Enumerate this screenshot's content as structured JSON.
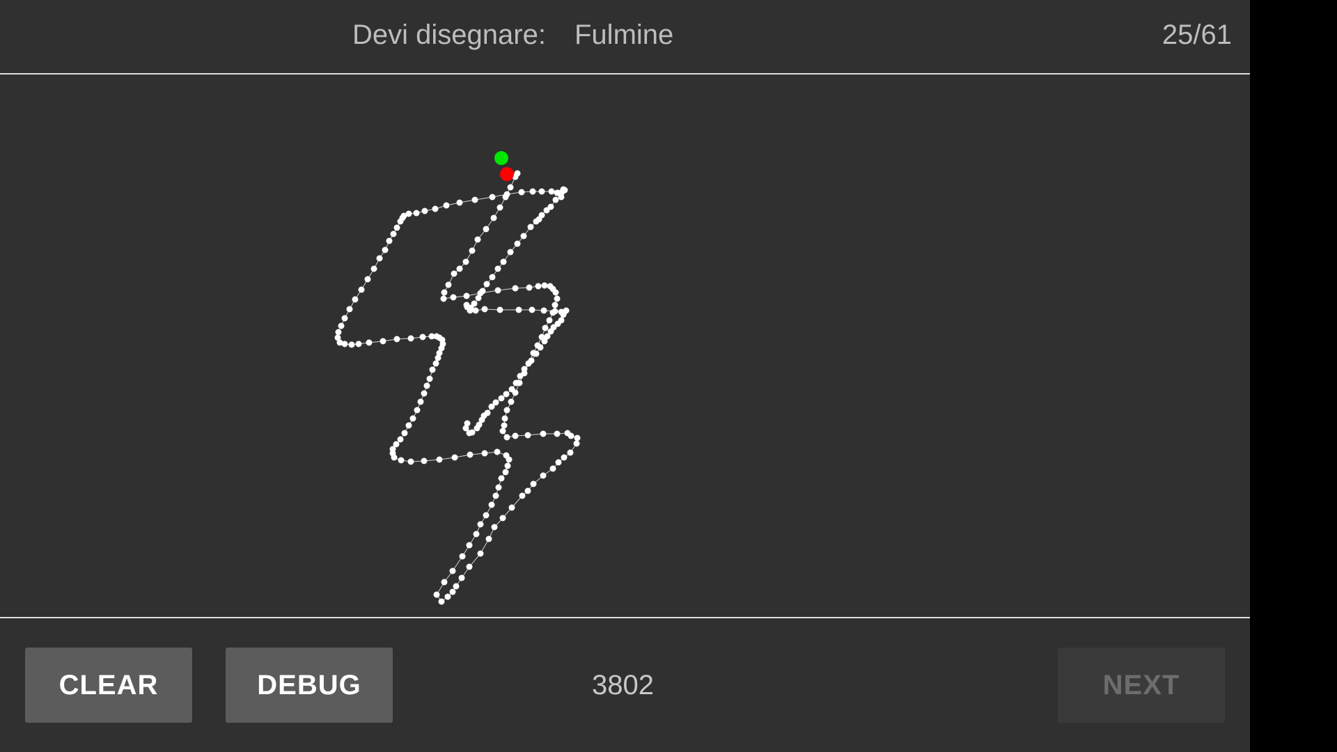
{
  "header": {
    "prompt_label": "Devi disegnare:",
    "prompt_word": "Fulmine",
    "progress": "25/61"
  },
  "footer": {
    "clear_label": "CLEAR",
    "debug_label": "DEBUG",
    "score": "3802",
    "next_label": "NEXT",
    "next_enabled": false
  },
  "drawing": {
    "stroke_color": "#ffffff",
    "start_marker_color": "#00e600",
    "end_marker_color": "#ff0000"
  },
  "colors": {
    "background": "#303030",
    "divider": "#e0e0e0",
    "button_bg": "#5c5c5d",
    "button_disabled_bg": "#3a3a3a",
    "text": "#bdbdbd"
  }
}
